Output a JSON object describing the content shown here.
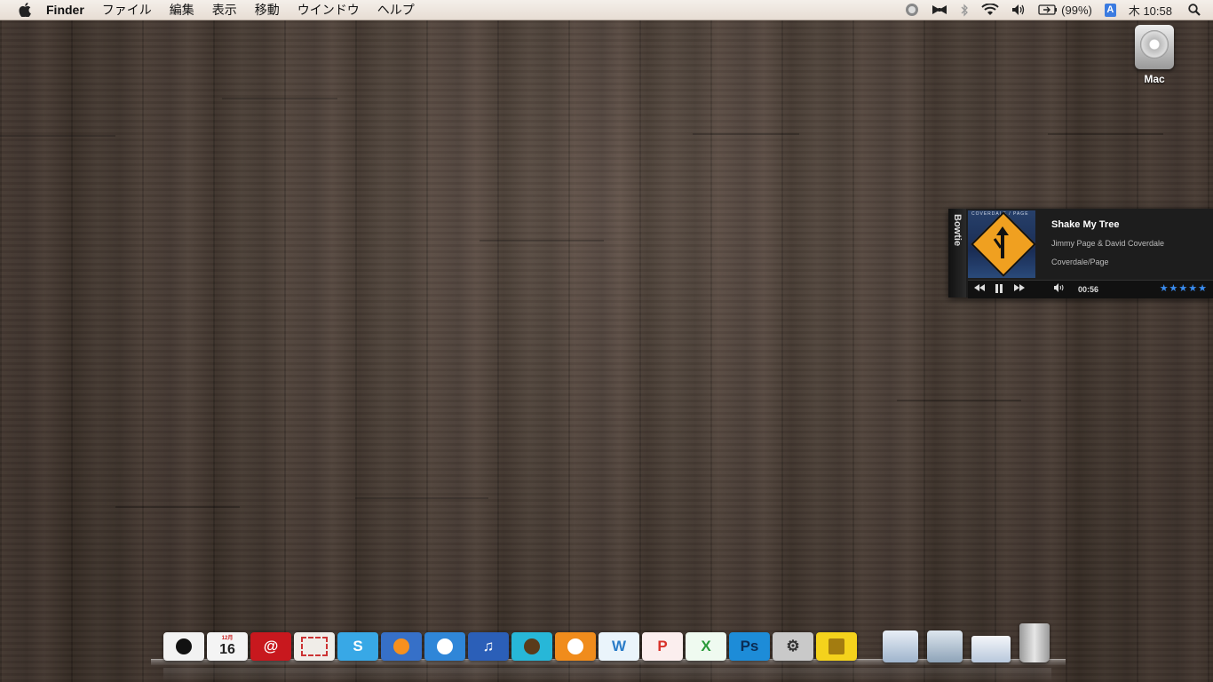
{
  "menubar": {
    "app_name": "Finder",
    "menus": [
      "ファイル",
      "編集",
      "表示",
      "移動",
      "ウインドウ",
      "ヘルプ"
    ],
    "battery_pct": "(99%)",
    "input_mode": "A",
    "clock": "木 10:58"
  },
  "desktop": {
    "disk_label": "Mac"
  },
  "bowtie": {
    "tab_label": "Bowtie",
    "album_art_text": "COVERDALE / PAGE",
    "track_title": "Shake My Tree",
    "artist": "Jimmy Page & David Coverdale",
    "album": "Coverdale/Page",
    "elapsed": "00:56",
    "rating_stars": 5,
    "rating_glyphs": "★★★★★",
    "star_color": "#3a8cf0"
  },
  "dock": {
    "calendar_day": "16",
    "calendar_month": "12月",
    "icons": [
      {
        "name": "adium-icon",
        "label": "",
        "bg": "#f2f2f2",
        "fg": "#111"
      },
      {
        "name": "ical-icon",
        "label": "16",
        "bg": "#f4f4f4",
        "fg": "#222"
      },
      {
        "name": "mail-icon",
        "label": "@",
        "bg": "#c8181e",
        "fg": "#fff"
      },
      {
        "name": "stamps-icon",
        "label": "",
        "bg": "#f0ede8",
        "fg": "#c33"
      },
      {
        "name": "skype-icon",
        "label": "S",
        "bg": "#38a8e6",
        "fg": "#fff"
      },
      {
        "name": "firefox-icon",
        "label": "",
        "bg": "#3670c8",
        "fg": "#f7901e"
      },
      {
        "name": "safari-icon",
        "label": "",
        "bg": "#2f86d8",
        "fg": "#fff"
      },
      {
        "name": "itunes-icon",
        "label": "♫",
        "bg": "#2b5fb8",
        "fg": "#fff"
      },
      {
        "name": "owl-icon",
        "label": "",
        "bg": "#27b7d8",
        "fg": "#5a3b1a"
      },
      {
        "name": "rss-icon",
        "label": "",
        "bg": "#f08c1c",
        "fg": "#fff"
      },
      {
        "name": "word-icon",
        "label": "W",
        "bg": "#eaf4fb",
        "fg": "#2a7cc8"
      },
      {
        "name": "powerpoint-icon",
        "label": "P",
        "bg": "#fbeeee",
        "fg": "#d8322a"
      },
      {
        "name": "excel-icon",
        "label": "X",
        "bg": "#effaf0",
        "fg": "#2a9a3a"
      },
      {
        "name": "photoshop-icon",
        "label": "Ps",
        "bg": "#1d8cd8",
        "fg": "#0b2d55"
      },
      {
        "name": "system-preferences-icon",
        "label": "⚙",
        "bg": "#c9c9c9",
        "fg": "#333"
      },
      {
        "name": "archive-icon",
        "label": "",
        "bg": "#f4d21c",
        "fg": "#a37c10"
      }
    ],
    "right_icons": [
      {
        "name": "applications-folder-icon"
      },
      {
        "name": "downloads-folder-icon"
      },
      {
        "name": "documents-stack-icon"
      },
      {
        "name": "trash-icon"
      }
    ]
  }
}
